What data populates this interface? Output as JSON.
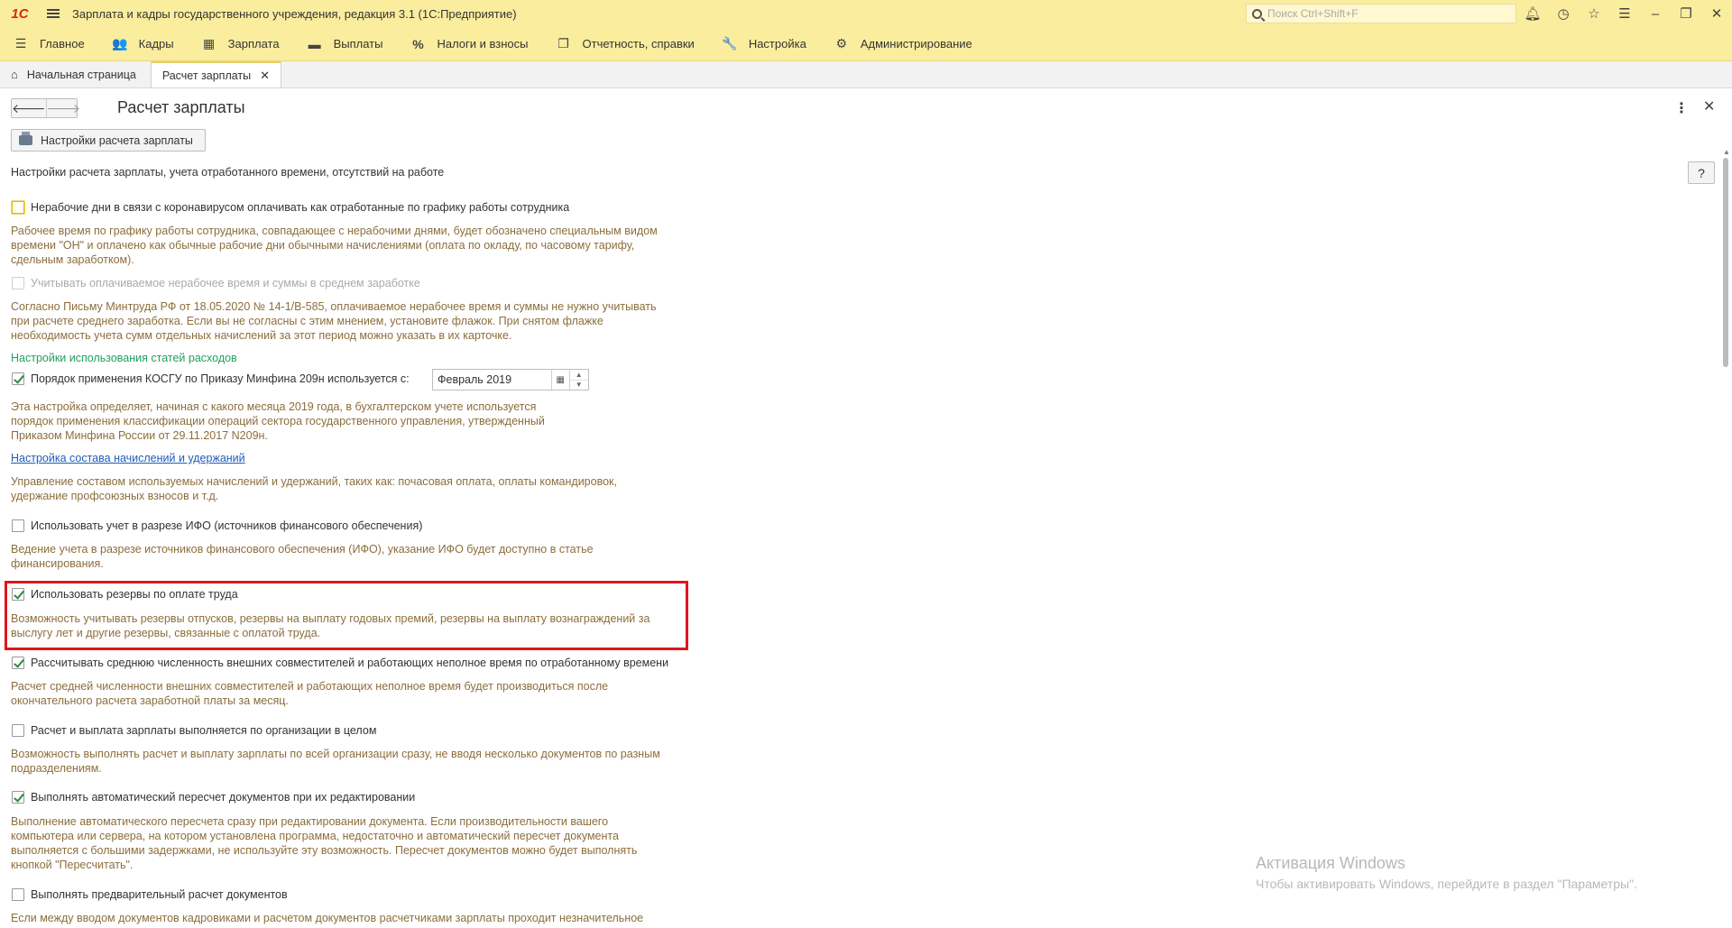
{
  "app": {
    "logo": "1С",
    "title": "Зарплата и кадры государственного учреждения, редакция 3.1  (1С:Предприятие)",
    "search_placeholder": "Поиск Ctrl+Shift+F"
  },
  "main_menu": [
    {
      "label": "Главное",
      "icon": "☰"
    },
    {
      "label": "Кадры",
      "icon": "👥"
    },
    {
      "label": "Зарплата",
      "icon": "▦"
    },
    {
      "label": "Выплаты",
      "icon": "▬"
    },
    {
      "label": "Налоги и взносы",
      "icon": "%"
    },
    {
      "label": "Отчетность, справки",
      "icon": "❐"
    },
    {
      "label": "Настройка",
      "icon": "🔧"
    },
    {
      "label": "Администрирование",
      "icon": "⚙"
    }
  ],
  "tabs": {
    "home": "Начальная страница",
    "active": "Расчет зарплаты"
  },
  "form": {
    "title": "Расчет зарплаты",
    "settings_button": "Настройки расчета зарплаты",
    "help": "?",
    "intro": "Настройки расчета зарплаты, учета отработанного времени, отсутствий на работе"
  },
  "options": {
    "covid": {
      "label": "Нерабочие дни в связи с коронавирусом оплачивать как отработанные по графику работы сотрудника",
      "checked": false,
      "desc": [
        "Рабочее время по графику работы сотрудника, совпадающее с нерабочими днями, будет обозначено специальным видом",
        "времени \"ОН\" и оплачено как обычные рабочие дни обычными начислениями (оплата по окладу, по часовому тарифу,",
        "сдельным заработком)."
      ]
    },
    "avg_earnings": {
      "label": "Учитывать оплачиваемое нерабочее время и суммы в среднем заработке",
      "checked": false,
      "desc": [
        "Согласно Письму Минтруда РФ от 18.05.2020 № 14-1/В-585, оплачиваемое нерабочее время и суммы не нужно учитывать",
        "при расчете среднего заработка. Если вы не согласны с этим мнением, установите флажок. При снятом флажке",
        "необходимость учета сумм отдельных начислений за этот период можно указать в их карточке."
      ]
    },
    "expense_section": "Настройки использования статей расходов",
    "kosgu": {
      "label": "Порядок применения КОСГУ по Приказу Минфина 209н используется с:",
      "checked": true,
      "date_value": "Февраль 2019",
      "desc": [
        "Эта настройка определяет, начиная с какого месяца 2019 года, в бухгалтерском учете используется",
        "порядок применения классификации операций сектора государственного управления, утвержденный",
        "Приказом Минфина России от 29.11.2017 N209н."
      ]
    },
    "accruals_link": {
      "label": "Настройка состава начислений и удержаний",
      "desc": [
        "Управление составом используемых начислений и удержаний, таких как: почасовая оплата, оплаты командировок,",
        "удержание профсоюзных взносов и т.д."
      ]
    },
    "ifo": {
      "label": "Использовать учет в разрезе ИФО (источников финансового обеспечения)",
      "checked": false,
      "desc": [
        "Ведение учета в разрезе источников финансового обеспечения (ИФО), указание ИФО будет доступно в статье",
        "финансирования."
      ]
    },
    "reserves": {
      "label": "Использовать резервы по оплате труда",
      "checked": true,
      "desc": [
        "Возможность учитывать резервы отпусков,  резервы на выплату годовых премий, резервы на выплату вознаграждений за",
        "выслугу лет и другие резервы, связанные с оплатой труда."
      ]
    },
    "avg_headcount": {
      "label": "Рассчитывать среднюю численность внешних совместителей и работающих неполное время по отработанному времени",
      "checked": true,
      "desc": [
        "Расчет средней численности внешних совместителей и работающих неполное время будет производиться после",
        "окончательного расчета заработной платы за месяц."
      ]
    },
    "org_whole": {
      "label": "Расчет и выплата зарплаты выполняется по организации в целом",
      "checked": false,
      "desc": [
        "Возможность выполнять расчет и выплату зарплаты по всей организации сразу, не вводя несколько документов по разным",
        "подразделениям."
      ]
    },
    "auto_recalc": {
      "label": "Выполнять автоматический пересчет документов при их редактировании",
      "checked": true,
      "desc": [
        "Выполнение автоматического пересчета сразу при редактировании документа. Если производительности вашего",
        "компьютера или сервера, на котором установлена программа, недостаточно и автоматический пересчет документа",
        "выполняется с большими задержками, не используйте эту возможность. Пересчет документов можно будет выполнять",
        "кнопкой \"Пересчитать\"."
      ]
    },
    "prelim": {
      "label": "Выполнять предварительный расчет документов",
      "checked": false,
      "desc": [
        "Если между вводом документов кадровиками и расчетом документов расчетчиками зарплаты проходит незначительное"
      ]
    }
  },
  "watermark": {
    "title": "Активация Windows",
    "subtitle": "Чтобы активировать Windows, перейдите в раздел \"Параметры\"."
  }
}
